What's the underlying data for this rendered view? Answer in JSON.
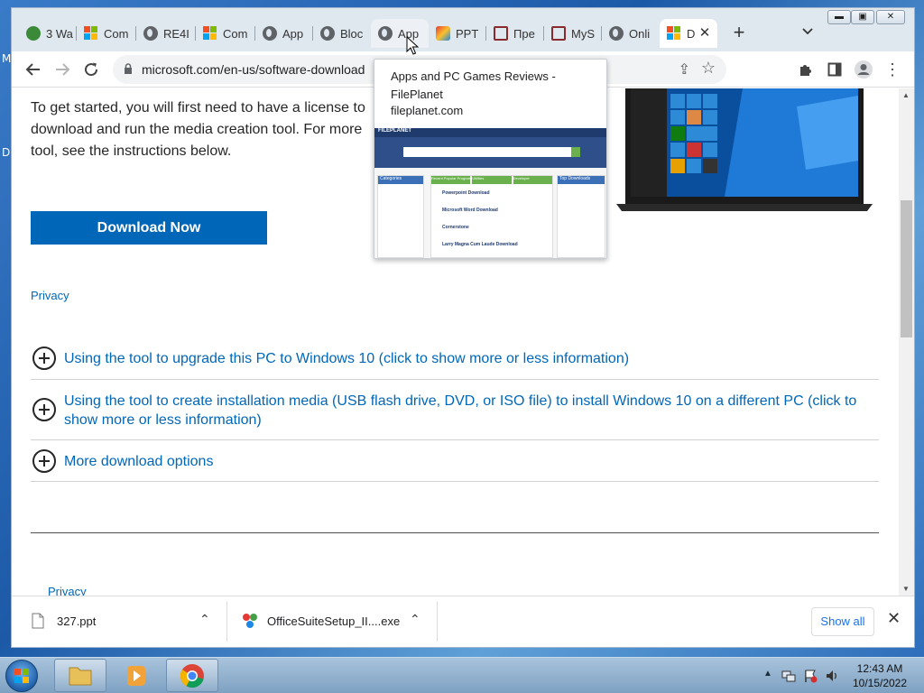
{
  "desktop": {
    "edge_letters": [
      "M",
      "D"
    ]
  },
  "browser": {
    "tabs": [
      {
        "title": "3 Wa",
        "icon": "green-app-icon"
      },
      {
        "title": "Com",
        "icon": "microsoft-logo-icon"
      },
      {
        "title": "RE4I",
        "icon": "globe-icon"
      },
      {
        "title": "Com",
        "icon": "microsoft-logo-icon"
      },
      {
        "title": "App",
        "icon": "globe-icon"
      },
      {
        "title": "Bloc",
        "icon": "globe-icon"
      },
      {
        "title": "App",
        "icon": "globe-icon"
      },
      {
        "title": "PPT",
        "icon": "gradient-app-icon"
      },
      {
        "title": "Пре",
        "icon": "presentation-icon"
      },
      {
        "title": "MyS",
        "icon": "presentation-icon"
      },
      {
        "title": "Onli",
        "icon": "globe-icon"
      },
      {
        "title": "D",
        "icon": "microsoft-logo-icon"
      }
    ],
    "url": "microsoft.com/en-us/software-download",
    "colors": {
      "accent": "#0067b8",
      "tabstrip": "#dfe7ef"
    }
  },
  "page": {
    "intro_text": "To get started, you will first need to have a license to download and run the media creation tool. For more tool, see the instructions below.",
    "download_button": "Download Now",
    "privacy_link_top": "Privacy",
    "accordion": [
      {
        "label": "Using the tool to upgrade this PC to Windows 10 (click to show more or less information)"
      },
      {
        "label": "Using the tool to create installation media (USB flash drive, DVD, or ISO file) to install Windows 10 on a different PC (click to show more or less information)"
      },
      {
        "label": "More download options"
      }
    ],
    "privacy_link_bottom": "Privacy"
  },
  "tooltip": {
    "title": "Apps and PC Games Reviews - FilePlanet",
    "domain": "fileplanet.com",
    "thumb": {
      "brand": "FILEPLANET",
      "tabs": [
        "Recent Popular Programs",
        "Utilities",
        "Developer"
      ],
      "sidebar_title": "Categories",
      "right_title": "Top Downloads",
      "items": [
        "Powerpoint Download",
        "Microsoft Word Download",
        "Cornerstone",
        "Larry Magna Cum Laude Download"
      ]
    }
  },
  "downloads": {
    "items": [
      {
        "name": "327.ppt"
      },
      {
        "name": "OfficeSuiteSetup_II....exe"
      }
    ],
    "show_all": "Show all"
  },
  "taskbar": {
    "time": "12:43 AM",
    "date": "10/15/2022"
  }
}
